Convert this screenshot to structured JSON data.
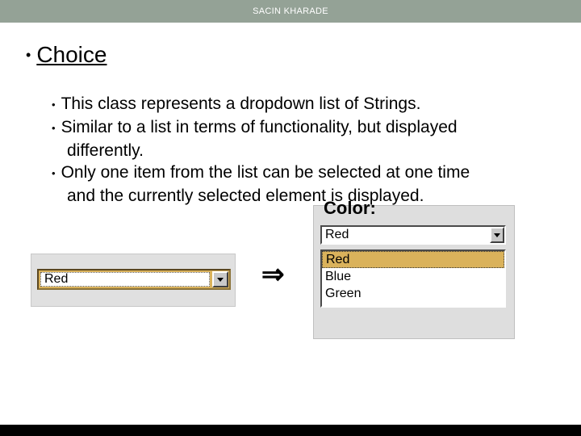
{
  "header": {
    "author": "SACIN KHARADE"
  },
  "title": "Choice",
  "bullets": [
    "This class represents a dropdown list of Strings.",
    "Similar to a list in terms of functionality, but displayed differently.",
    "Only one item from the list can be selected at one time and the currently selected element is displayed."
  ],
  "figure": {
    "arrow": "⇒",
    "left": {
      "selected": "Red"
    },
    "right": {
      "label_fragment": "Color:",
      "selected": "Red",
      "options": [
        "Red",
        "Blue",
        "Green"
      ]
    }
  }
}
